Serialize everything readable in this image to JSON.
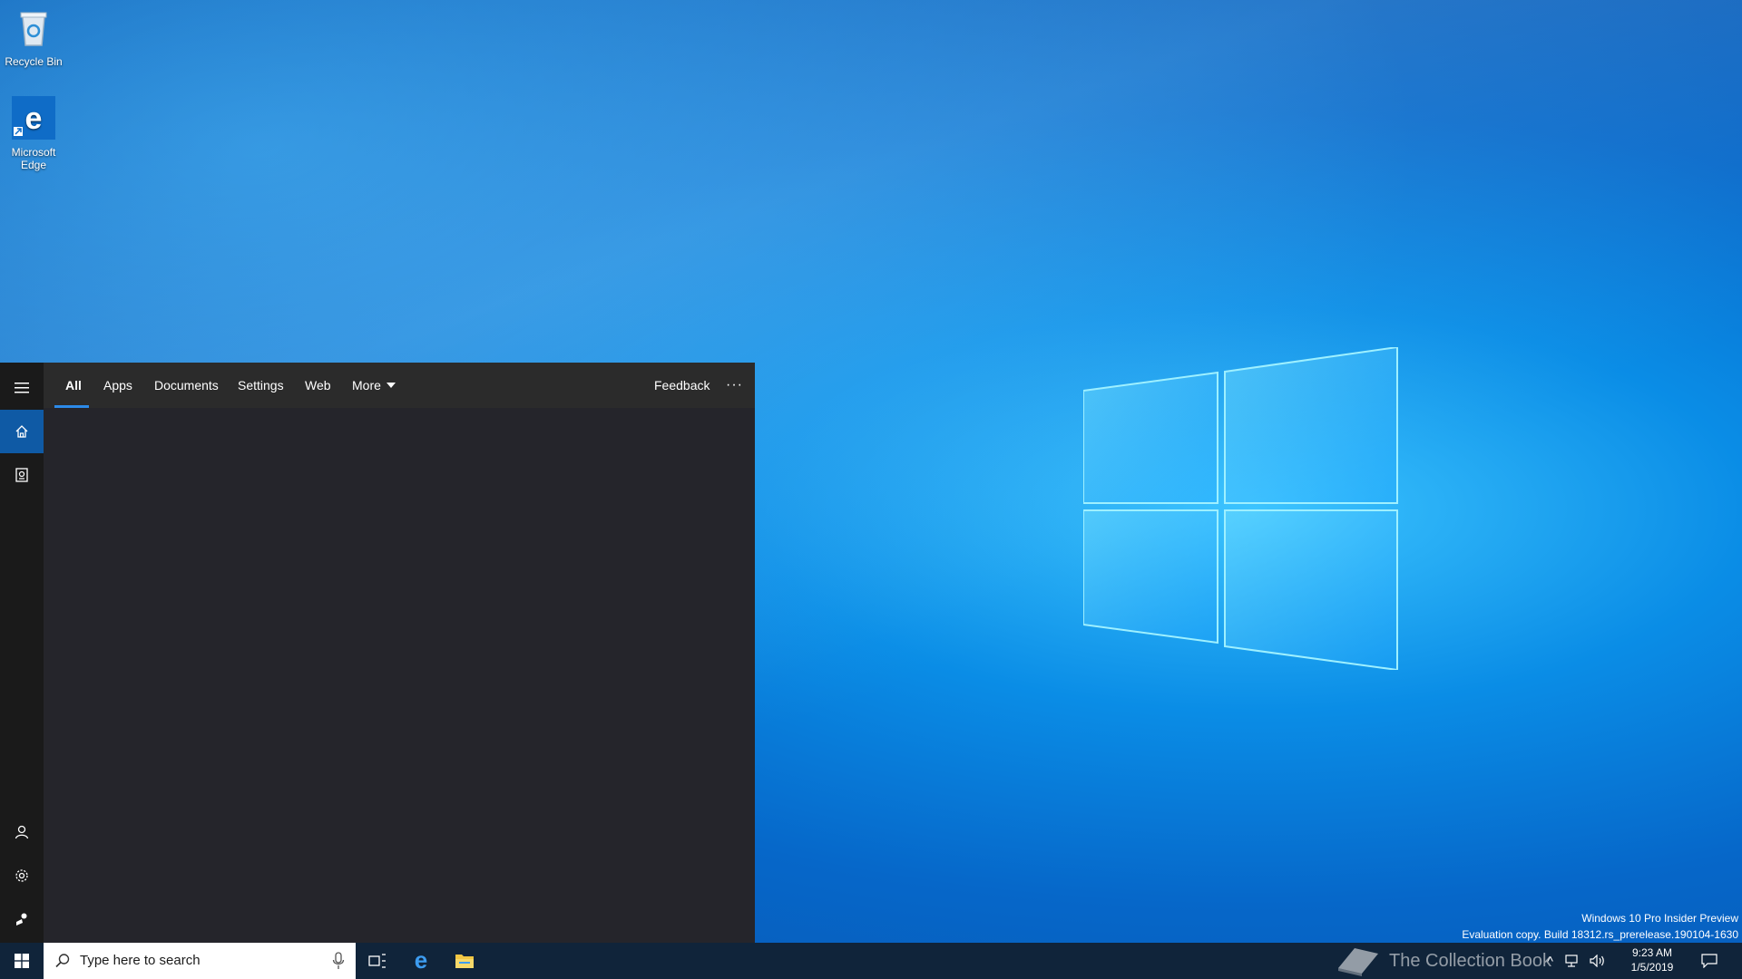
{
  "desktop": {
    "icons": [
      {
        "label": "Recycle Bin",
        "icon": "recycle-bin-icon"
      },
      {
        "label": "Microsoft Edge",
        "icon": "edge-icon"
      }
    ],
    "watermark": {
      "line1": "Windows 10 Pro Insider Preview",
      "line2": "Evaluation copy. Build 18312.rs_prerelease.190104-1630"
    }
  },
  "search_panel": {
    "tabs": [
      {
        "label": "All",
        "active": true
      },
      {
        "label": "Apps"
      },
      {
        "label": "Documents"
      },
      {
        "label": "Settings"
      },
      {
        "label": "Web"
      },
      {
        "label": "More"
      }
    ],
    "feedback_label": "Feedback",
    "more_options_label": "···",
    "rail": [
      "hamburger-menu-icon",
      "home-icon",
      "notebook-icon",
      "account-icon",
      "settings-icon",
      "feedback-hub-icon"
    ]
  },
  "taskbar": {
    "search_placeholder": "Type here to search",
    "apps": [
      "task-view-icon",
      "edge-icon",
      "file-explorer-icon"
    ],
    "clock_time": "9:23 AM",
    "clock_date": "1/5/2019",
    "overlay_logo_text": "The Collection Book"
  },
  "colors": {
    "accent": "#0f5aa5",
    "tab_underline": "#2c8ae8",
    "panel_bg": "#25252b",
    "taskbar_bg": "#10243a"
  }
}
